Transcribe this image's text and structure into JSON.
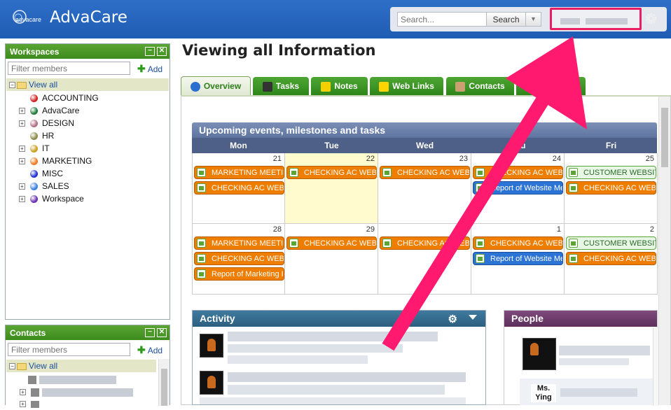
{
  "app": {
    "title": "AdvaCare",
    "logo_text": "advacare"
  },
  "search": {
    "placeholder": "Search...",
    "button_label": "Search"
  },
  "page_title": "Viewing all Information",
  "tabs": [
    {
      "label": "Overview",
      "icon": "globe-icon"
    },
    {
      "label": "Tasks",
      "icon": "clipboard-icon"
    },
    {
      "label": "Notes",
      "icon": "note-icon"
    },
    {
      "label": "Web Links",
      "icon": "star-icon"
    },
    {
      "label": "Contacts",
      "icon": "person-icon"
    },
    {
      "label": "dar",
      "icon": "calendar-icon"
    }
  ],
  "workspaces": {
    "title": "Workspaces",
    "filter_placeholder": "Filter members",
    "add_label": "Add",
    "view_all": "View all",
    "items": [
      {
        "label": "ACCOUNTING",
        "color": "#d32020",
        "expandable": false
      },
      {
        "label": "AdvaCare",
        "color": "#1e7a3a",
        "expandable": true
      },
      {
        "label": "DESIGN",
        "color": "#b07080",
        "expandable": true
      },
      {
        "label": "HR",
        "color": "#8a8a4a",
        "expandable": false
      },
      {
        "label": "IT",
        "color": "#c8a020",
        "expandable": true
      },
      {
        "label": "MARKETING",
        "color": "#f07a20",
        "expandable": true
      },
      {
        "label": "MISC",
        "color": "#2030d0",
        "expandable": false
      },
      {
        "label": "SALES",
        "color": "#3a80e0",
        "expandable": true
      },
      {
        "label": "Workspace",
        "color": "#6a30b0",
        "expandable": true
      }
    ]
  },
  "contacts": {
    "title": "Contacts",
    "filter_placeholder": "Filter members",
    "add_label": "Add",
    "view_all": "View all"
  },
  "calendar": {
    "title": "Upcoming events, milestones and tasks",
    "days": [
      "Mon",
      "Tue",
      "Wed",
      "Thu",
      "Fri"
    ],
    "weeks": [
      {
        "dates": [
          "21",
          "22",
          "23",
          "24",
          "25"
        ],
        "events": [
          [
            {
              "label": "MARKETING MEETIN",
              "style": "orange"
            },
            {
              "label": "CHECKING AC WEBS",
              "style": "orange"
            }
          ],
          [
            {
              "label": "CHECKING AC WEBS",
              "style": "orange"
            }
          ],
          [
            {
              "label": "CHECKING AC WEBS",
              "style": "orange"
            }
          ],
          [
            {
              "label": "CHECKING AC WEBS",
              "style": "orange"
            },
            {
              "label": "Report of Website Me",
              "style": "blue"
            }
          ],
          [
            {
              "label": "CUSTOMER WEBSITE",
              "style": "light"
            },
            {
              "label": "CHECKING AC WEBS",
              "style": "orange"
            }
          ]
        ]
      },
      {
        "dates": [
          "28",
          "29",
          "30",
          "1",
          "2"
        ],
        "events": [
          [
            {
              "label": "MARKETING MEETIN",
              "style": "orange"
            },
            {
              "label": "CHECKING AC WEBS",
              "style": "orange"
            },
            {
              "label": "Report of Marketing I",
              "style": "orange"
            }
          ],
          [
            {
              "label": "CHECKING AC WEBS",
              "style": "orange"
            }
          ],
          [
            {
              "label": "CHECKING AC WEBS",
              "style": "orange"
            }
          ],
          [
            {
              "label": "CHECKING AC WEBS",
              "style": "orange"
            },
            {
              "label": "Report of Website Me",
              "style": "blue"
            }
          ],
          [
            {
              "label": "CUSTOMER WEBSITE",
              "style": "light"
            },
            {
              "label": "CHECKING AC WEBS",
              "style": "orange"
            }
          ]
        ]
      }
    ]
  },
  "activity": {
    "title": "Activity"
  },
  "people": {
    "title": "People",
    "person_name": "Ms. Ying"
  },
  "colors": {
    "header_blue": "#2f6fc8",
    "panel_green": "#3d8b1e",
    "event_orange": "#ef7d00",
    "annotation_pink": "#e91e63"
  }
}
